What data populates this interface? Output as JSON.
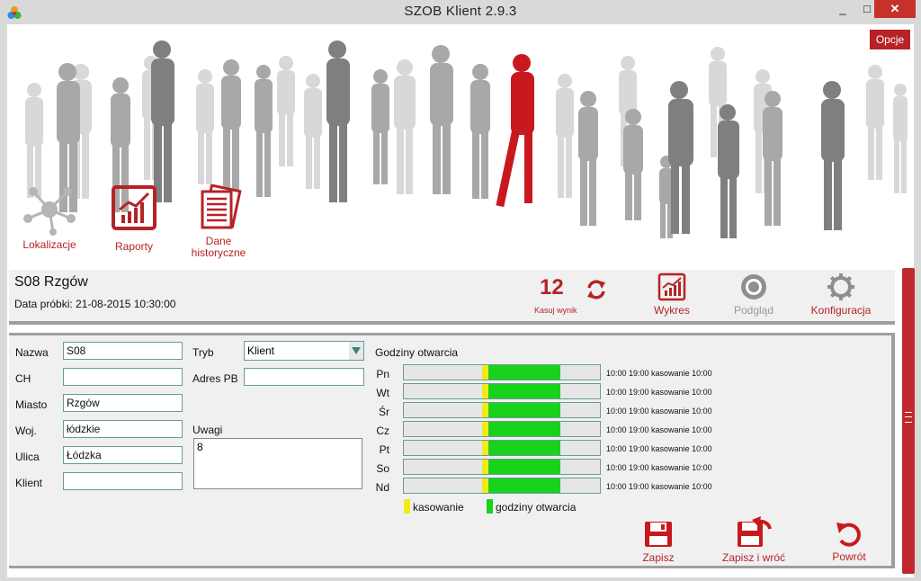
{
  "window": {
    "title": "SZOB Klient  2.9.3",
    "min_label": "_",
    "max_label": "□",
    "close_label": "✕"
  },
  "options_button": "Opcje",
  "nav": [
    {
      "label": "Lokalizacje",
      "icon": "network-icon"
    },
    {
      "label": "Raporty",
      "icon": "chart-icon"
    },
    {
      "label_line1": "Dane",
      "label_line2": "historyczne",
      "icon": "documents-icon"
    }
  ],
  "store": {
    "name": "S08 Rzgów",
    "sample_date": "Data próbki: 21-08-2015 10:30:00"
  },
  "counter": {
    "value": "12",
    "reset_label": "Kasuj wynik"
  },
  "toolbar": {
    "chart_label": "Wykres",
    "preview_label": "Podgląd",
    "config_label": "Konfiguracja"
  },
  "form": {
    "nazwa_label": "Nazwa",
    "nazwa_value": "S08",
    "ch_label": "CH",
    "ch_value": "",
    "miasto_label": "Miasto",
    "miasto_value": "Rzgów",
    "woj_label": "Woj.",
    "woj_value": "łódzkie",
    "ulica_label": "Ulica",
    "ulica_value": "Łódzka",
    "klient_label": "Klient",
    "klient_value": "",
    "tryb_label": "Tryb",
    "tryb_value": "Klient",
    "adres_label": "Adres PB",
    "adres_value": "",
    "uwagi_label": "Uwagi",
    "uwagi_value": "8"
  },
  "opening_hours": {
    "title": "Godziny otwarcia",
    "days": [
      {
        "day": "Pn",
        "text": "10:00 19:00 kasowanie 10:00"
      },
      {
        "day": "Wt",
        "text": "10:00 19:00 kasowanie 10:00"
      },
      {
        "day": "Śr",
        "text": "10:00 19:00 kasowanie 10:00"
      },
      {
        "day": "Cz",
        "text": "10:00 19:00 kasowanie 10:00"
      },
      {
        "day": "Pt",
        "text": "10:00 19:00 kasowanie 10:00"
      },
      {
        "day": "So",
        "text": "10:00 19:00 kasowanie 10:00"
      },
      {
        "day": "Nd",
        "text": "10:00 19:00 kasowanie 10:00"
      }
    ],
    "legend_reset": "kasowanie",
    "legend_open": "godziny otwarcia",
    "colors": {
      "reset": "#f2ea16",
      "open": "#18d21c"
    }
  },
  "actions": {
    "save": "Zapisz",
    "save_back": "Zapisz i wróć",
    "back": "Powrót"
  },
  "colors": {
    "accent": "#b52327",
    "frame": "#d9d9d9",
    "panel": "#f0f0f0"
  }
}
